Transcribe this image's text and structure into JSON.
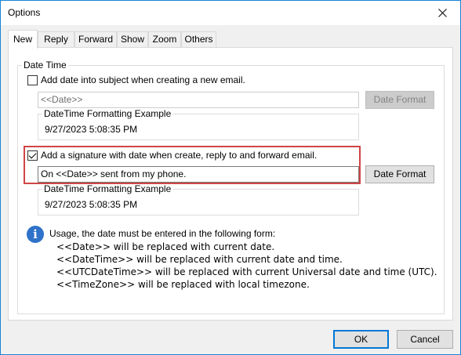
{
  "window": {
    "title": "Options"
  },
  "tabs": [
    {
      "label": "New",
      "active": true
    },
    {
      "label": "Reply"
    },
    {
      "label": "Forward"
    },
    {
      "label": "Show"
    },
    {
      "label": "Zoom"
    },
    {
      "label": "Others"
    }
  ],
  "datetime_group": {
    "caption": "Date Time",
    "subject_checkbox": {
      "label": "Add date into subject when creating a new email.",
      "checked": false
    },
    "subject_input": {
      "value": "<<Date>>"
    },
    "subject_format_button": "Date Format",
    "subject_example": {
      "caption": "DateTime Formatting Example",
      "value": "9/27/2023 5:08:35 PM"
    },
    "signature_checkbox": {
      "label": "Add a signature with date when create, reply to and forward email.",
      "checked": true
    },
    "signature_input": {
      "value": "On <<Date>> sent from my phone."
    },
    "signature_format_button": "Date Format",
    "signature_example": {
      "caption": "DateTime Formatting Example",
      "value": "9/27/2023 5:08:35 PM"
    }
  },
  "usage": {
    "intro": "Usage, the date must be entered in the following form:",
    "lines": [
      "<<Date>> will be replaced with current date.",
      "<<DateTime>> will be replaced with current date and time.",
      "<<UTCDateTime>> will be replaced with current Universal date and time (UTC).",
      "<<TimeZone>> will be replaced with local timezone."
    ]
  },
  "footer": {
    "ok": "OK",
    "cancel": "Cancel"
  },
  "colors": {
    "accent": "#0078d7",
    "highlight": "#d04545",
    "info": "#2e72c9"
  }
}
